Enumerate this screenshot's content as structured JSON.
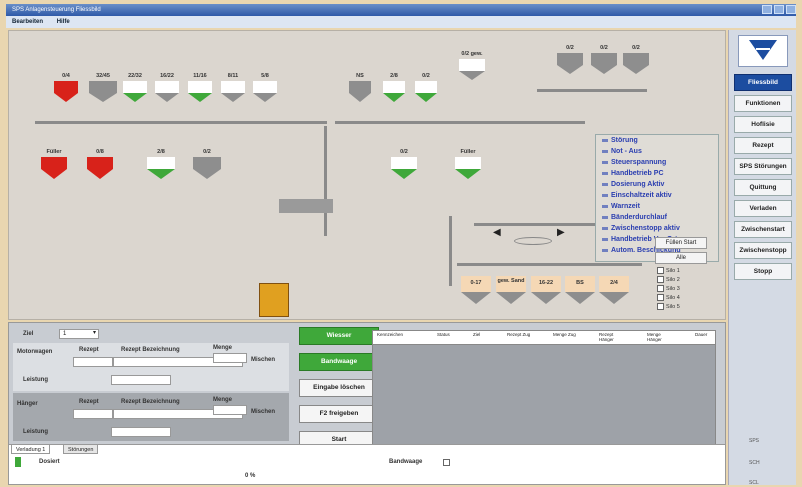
{
  "window": {
    "title": "SPS Anlagensteuerung Fliessbild"
  },
  "menu": [
    "Bearbeiten",
    "Hilfe"
  ],
  "top_silos": [
    "0/4",
    "32/45",
    "22/32",
    "16/22",
    "11/16",
    "8/11",
    "5/8"
  ],
  "top_right_silos": [
    "NS",
    "2/8",
    "0/2"
  ],
  "top_right_far_silos": [
    "0/2 gew.",
    "0/2",
    "0/2",
    "0/2"
  ],
  "mid_silos": [
    "Füller",
    "0/8",
    "2/8",
    "0/2",
    "0/2",
    "Füller"
  ],
  "bottom_silos": [
    "0-17",
    "gew. Sand",
    "16-22",
    "BS",
    "2/4"
  ],
  "legend": [
    "Störung",
    "Not - Aus",
    "Steuerspannung",
    "Handbetrieb PC",
    "Dosierung Aktiv",
    "Einschaltzeit aktiv",
    "Warnzeit",
    "Bänderdurchlauf",
    "Zwischenstopp aktiv",
    "Handbetrieb Vor Ort",
    "Autom. Beschickung"
  ],
  "fill_panel": {
    "start": "Füllen Start",
    "all": "Alle",
    "silos": [
      "Silo 1",
      "Silo 2",
      "Silo 3",
      "Silo 4",
      "Silo 5"
    ]
  },
  "sidebar": {
    "buttons": [
      "Fliessbild",
      "Funktionen",
      "Hoflisie",
      "Rezept",
      "SPS Störungen",
      "Quittung",
      "Verladen",
      "Zwischenstart",
      "Zwischenstopp",
      "Stopp"
    ],
    "active": "Fliessbild",
    "status_labels": [
      "SPS",
      "SCH",
      "SCL"
    ]
  },
  "bottom": {
    "ziel_label": "Ziel",
    "ziel_value": "1",
    "motorwagen_label": "Motorwagen",
    "rezept_label": "Rezept",
    "rezept_bez_label": "Rezept Bezeichnung",
    "menge_label": "Menge",
    "mischen_label": "Mischen",
    "leistung_label": "Leistung",
    "haenger_label": "Hänger",
    "buttons": [
      "Wiesser",
      "Bandwaage",
      "Eingabe löschen",
      "F2 freigeben",
      "Start"
    ],
    "grid_headers": [
      "Kennzeichen",
      "Status",
      "Ziel",
      "Rezept Zug",
      "Menge Zug",
      "Rezept Hänger",
      "Menge Hänger",
      "Dauer"
    ],
    "tabs": [
      "Verladung 1",
      "Störungen"
    ],
    "dosiert_label": "Dosiert",
    "bandwaage_label": "Bandwaage",
    "progress_text": "0 %"
  },
  "colors": {
    "accent": "#1c4da0",
    "alarm": "#d8221a",
    "ok": "#3fa83a"
  }
}
